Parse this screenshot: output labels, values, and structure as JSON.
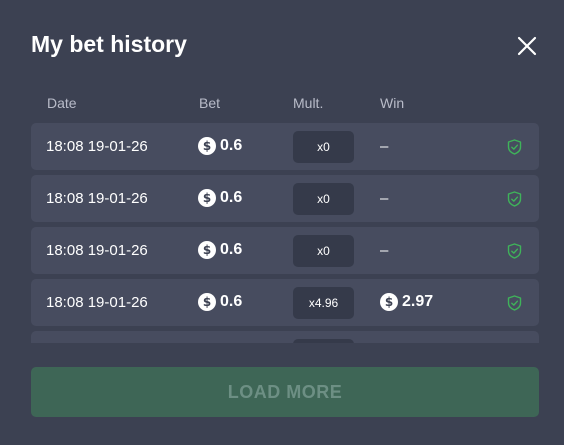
{
  "modal": {
    "title": "My bet history",
    "close_icon": "close-icon"
  },
  "columns": {
    "date": "Date",
    "bet": "Bet",
    "mult": "Mult.",
    "win": "Win"
  },
  "currency_symbol": "$",
  "rows": [
    {
      "date": "18:08 19-01-26",
      "bet": "0.6",
      "mult": "x0",
      "win": "–",
      "verified_icon": "shield-check-icon"
    },
    {
      "date": "18:08 19-01-26",
      "bet": "0.6",
      "mult": "x0",
      "win": "–",
      "verified_icon": "shield-check-icon"
    },
    {
      "date": "18:08 19-01-26",
      "bet": "0.6",
      "mult": "x0",
      "win": "–",
      "verified_icon": "shield-check-icon"
    },
    {
      "date": "18:08 19-01-26",
      "bet": "0.6",
      "mult": "x4.96",
      "win": "2.97",
      "verified_icon": "shield-check-icon"
    }
  ],
  "load_more_label": "LOAD MORE",
  "colors": {
    "background": "#3c4152",
    "row": "#474c5f",
    "mult_chip": "#353a4a",
    "verified": "#3fb35a",
    "load_more_bg": "#3e6656",
    "load_more_text": "#6d8f84"
  }
}
